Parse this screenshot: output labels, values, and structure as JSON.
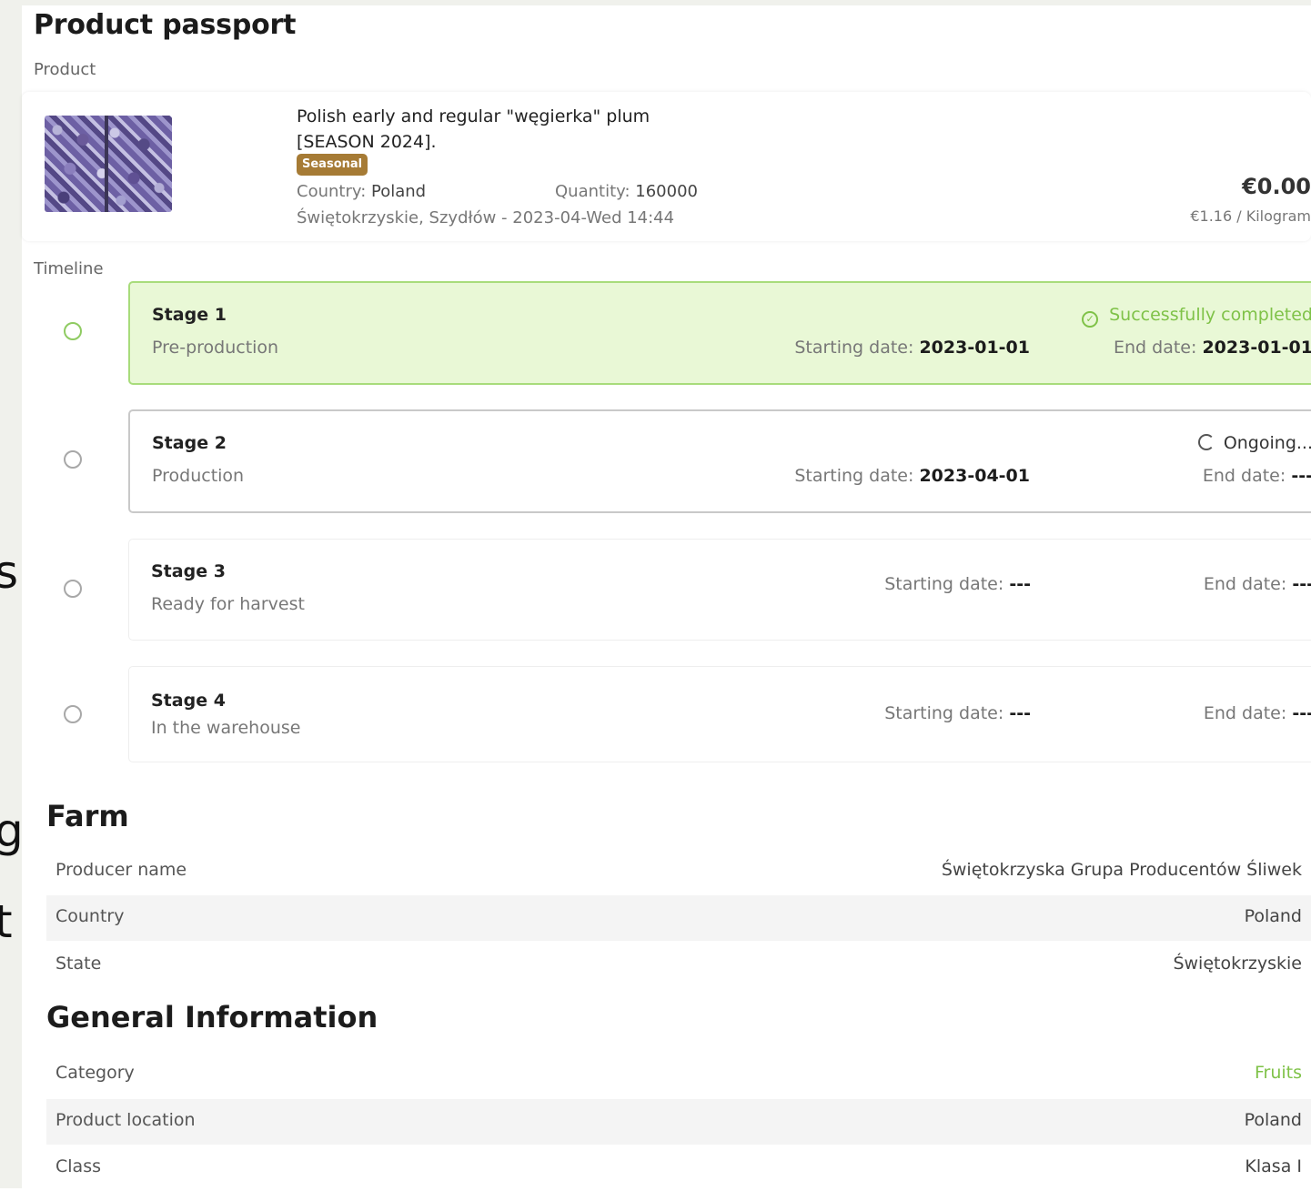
{
  "left_fragments": [
    "s",
    "g",
    "t"
  ],
  "page": {
    "title": "Product passport",
    "product_label": "Product",
    "timeline_label": "Timeline"
  },
  "product": {
    "name": "Polish early and regular \"węgierka\" plum [SEASON 2024].",
    "badge": "Seasonal",
    "country_label": "Country:",
    "country": "Poland",
    "quantity_label": "Quantity:",
    "quantity": "160000",
    "location_date": "Świętokrzyskie, Szydłów - 2023-04-Wed 14:44",
    "price": "€0.00",
    "unit_price": "€1.16 / Kilogram"
  },
  "stages": [
    {
      "title": "Stage 1",
      "subtitle": "Pre-production",
      "start_label": "Starting date:",
      "start": "2023-01-01",
      "end_label": "End date:",
      "end": "2023-01-01",
      "status": "Successfully completed",
      "state": "completed"
    },
    {
      "title": "Stage 2",
      "subtitle": "Production",
      "start_label": "Starting date:",
      "start": "2023-04-01",
      "end_label": "End date:",
      "end": "---",
      "status": "Ongoing...",
      "state": "ongoing"
    },
    {
      "title": "Stage 3",
      "subtitle": "Ready for harvest",
      "start_label": "Starting date:",
      "start": "---",
      "end_label": "End date:",
      "end": "---",
      "status": "",
      "state": "pending"
    },
    {
      "title": "Stage 4",
      "subtitle": "In the warehouse",
      "start_label": "Starting date:",
      "start": "---",
      "end_label": "End date:",
      "end": "---",
      "status": "",
      "state": "pending"
    }
  ],
  "farm": {
    "heading": "Farm",
    "rows": [
      {
        "key": "Producer name",
        "value": "Świętokrzyska Grupa Producentów Śliwek"
      },
      {
        "key": "Country",
        "value": "Poland"
      },
      {
        "key": "State",
        "value": "Świętokrzyskie"
      }
    ]
  },
  "general": {
    "heading": "General Information",
    "rows": [
      {
        "key": "Category",
        "value": "Fruits"
      },
      {
        "key": "Product location",
        "value": "Poland"
      },
      {
        "key": "Class",
        "value": "Klasa I"
      }
    ]
  },
  "colors": {
    "success": "#7fc248",
    "completed_bg": "#e9f8d6",
    "badge": "#a67b35"
  }
}
